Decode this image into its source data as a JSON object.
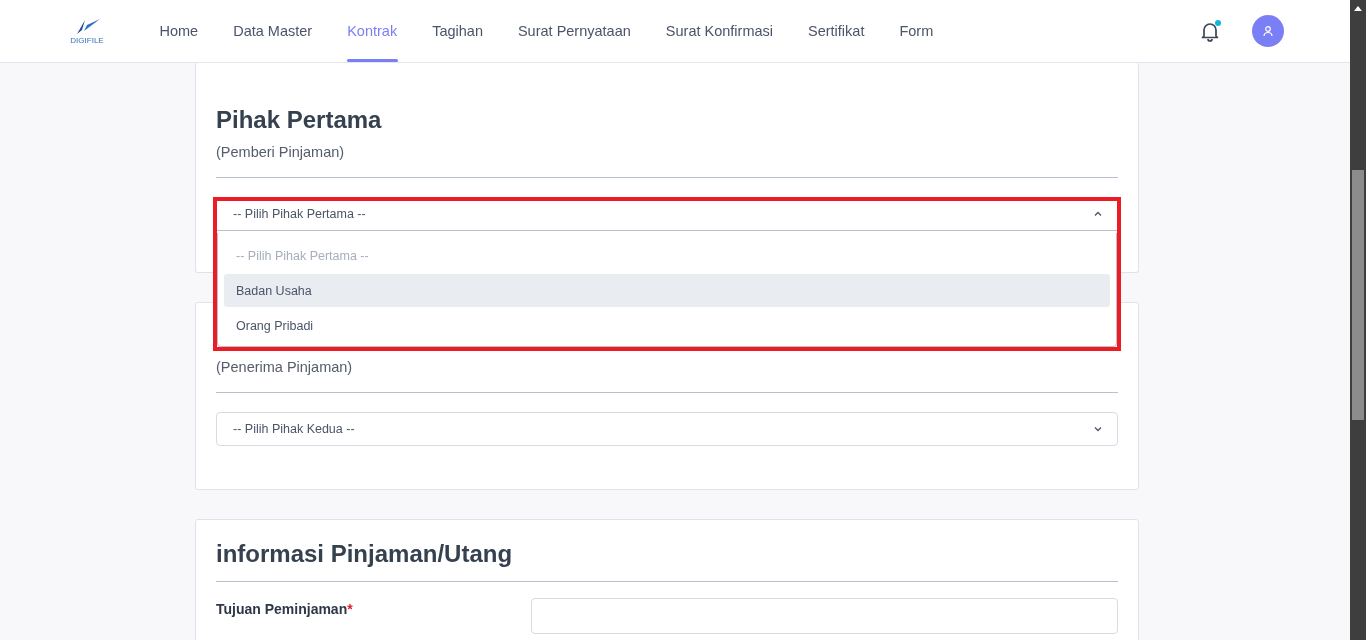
{
  "header": {
    "logo_text": "DIGIFILE",
    "has_unread": true,
    "nav": [
      {
        "label": "Home",
        "selected": false
      },
      {
        "label": "Data Master",
        "selected": false
      },
      {
        "label": "Kontrak",
        "selected": true
      },
      {
        "label": "Tagihan",
        "selected": false
      },
      {
        "label": "Surat Pernyataan",
        "selected": false
      },
      {
        "label": "Surat Konfirmasi",
        "selected": false
      },
      {
        "label": "Sertifikat",
        "selected": false
      },
      {
        "label": "Form",
        "selected": false
      }
    ]
  },
  "pihak_pertama": {
    "title": "Pihak Pertama",
    "subtitle": "(Pemberi Pinjaman)",
    "highlighted": true,
    "select": {
      "value": "-- Pilih Pihak Pertama --",
      "open": true,
      "options": [
        {
          "label": "-- Pilih Pihak Pertama --",
          "kind": "placeholder",
          "highlighted": false
        },
        {
          "label": "Badan Usaha",
          "kind": "option",
          "highlighted": true
        },
        {
          "label": "Orang Pribadi",
          "kind": "option",
          "highlighted": false
        }
      ]
    }
  },
  "pihak_kedua": {
    "subtitle": "(Penerima Pinjaman)",
    "select": {
      "value": "-- Pilih Pihak Kedua --",
      "open": false
    }
  },
  "informasi": {
    "title": "informasi Pinjaman/Utang",
    "fields": [
      {
        "label": "Tujuan Peminjaman",
        "required_mark": "*"
      }
    ]
  }
}
